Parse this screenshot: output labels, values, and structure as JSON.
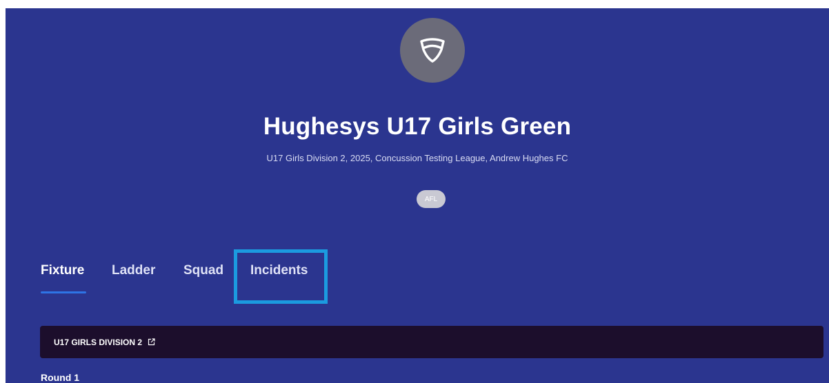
{
  "header": {
    "logo_icon": "shield-logo-icon",
    "team_name": "Hughesys U17 Girls Green",
    "subtitle": "U17 Girls Division 2, 2025, Concussion Testing League, Andrew Hughes FC",
    "sport_badge": "AFL"
  },
  "tabs": {
    "fixture": "Fixture",
    "ladder": "Ladder",
    "squad": "Squad",
    "incidents": "Incidents",
    "active": "Fixture"
  },
  "highlight": {
    "target": "Incidents",
    "color": "#1b9be0"
  },
  "division": {
    "label": "U17 GIRLS DIVISION 2",
    "link_icon": "external-link-icon"
  },
  "round": {
    "label": "Round 1"
  },
  "colors": {
    "background": "#2b358f",
    "accent": "#2e74e6",
    "division_bar": "#1c0e2c"
  }
}
